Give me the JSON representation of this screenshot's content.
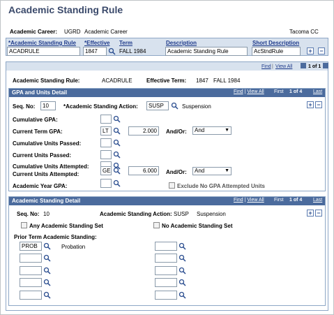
{
  "title": "Academic Standing Rule",
  "career": {
    "label": "Academic Career:",
    "code": "UGRD",
    "name": "Academic Career",
    "institution": "Tacoma CC"
  },
  "header_grid": {
    "columns": [
      "*Academic Standing Rule",
      "*Effective",
      "Term",
      "Description",
      "Short Description"
    ],
    "rule": "ACADRULE",
    "effective": "1847",
    "term": "FALL 1984",
    "description": "Academic Standing Rule",
    "short_description": "AcStndRule"
  },
  "rule_box": {
    "nav": {
      "find": "Find",
      "view_all": "View All",
      "count": "1 of 1"
    },
    "rule_label": "Academic Standing Rule:",
    "rule_value": "ACADRULE",
    "term_label": "Effective Term:",
    "term_code": "1847",
    "term_name": "FALL 1984"
  },
  "gpa_section": {
    "title": "GPA and Units Detail",
    "nav": {
      "find": "Find",
      "view_all": "View All",
      "first": "First",
      "count": "1 of 4",
      "last": "Last"
    },
    "seq_label": "Seq. No:",
    "seq_value": "10",
    "action_label": "*Academic Standing Action:",
    "action_value": "SUSP",
    "action_desc": "Suspension",
    "rows": [
      {
        "label": "Cumulative GPA:",
        "op": "",
        "value": "",
        "andor": ""
      },
      {
        "label": "Current Term GPA:",
        "op": "LT",
        "value": "2.000",
        "andor": "And"
      },
      {
        "label": "Cumulative Units Passed:",
        "op": "",
        "value": "",
        "andor": ""
      },
      {
        "label": "Current Units Passed:",
        "op": "",
        "value": "",
        "andor": ""
      },
      {
        "label": "Cumulative Units Attempted:",
        "op": "",
        "value": "",
        "andor": ""
      },
      {
        "label": "Current Units Attempted:",
        "op": "GE",
        "value": "6.000",
        "andor": "And"
      },
      {
        "label": "Academic Year GPA:",
        "op": "",
        "value": "",
        "andor": ""
      }
    ],
    "andor_label": "And/Or:",
    "exclude_label": "Exclude No GPA Attempted Units"
  },
  "detail_section": {
    "title": "Academic Standing Detail",
    "nav": {
      "find": "Find",
      "view_all": "View All",
      "first": "First",
      "count": "1 of 4",
      "last": "Last"
    },
    "seq_label": "Seq. No:",
    "seq_value": "10",
    "action_label": "Academic Standing Action:",
    "action_code": "SUSP",
    "action_desc": "Suspension",
    "any_label": "Any Academic Standing Set",
    "no_label": "No Academic Standing Set",
    "prior_label": "Prior Term Academic Standing:",
    "prior_first_code": "PROB",
    "prior_first_desc": "Probation"
  }
}
